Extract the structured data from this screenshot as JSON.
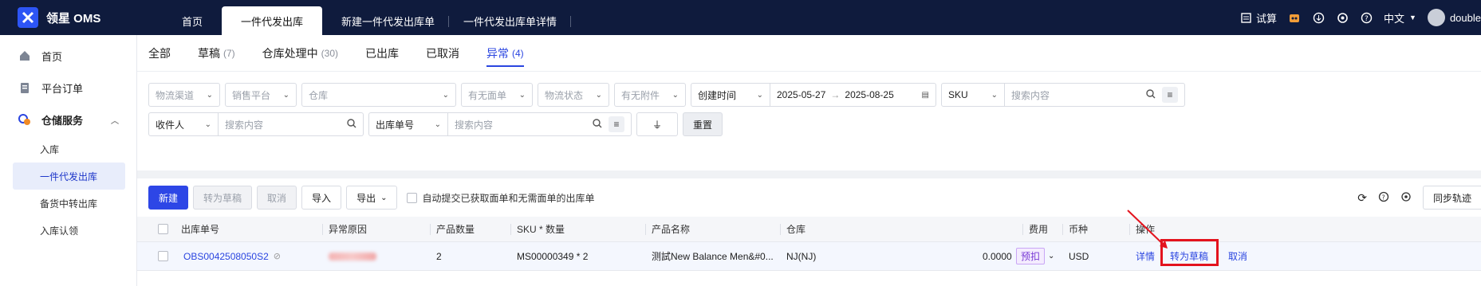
{
  "app": {
    "title": "领星 OMS"
  },
  "topbar": {
    "tabs": [
      {
        "label": "首页"
      },
      {
        "label": "一件代发出库"
      },
      {
        "label": "新建一件代发出库单"
      },
      {
        "label": "一件代发出库单详情"
      }
    ],
    "trial": "试算",
    "language": "中文",
    "user": "double"
  },
  "sidebar": {
    "home": "首页",
    "orders": "平台订单",
    "warehouse": "仓储服务",
    "subitems": [
      "入库",
      "一件代发出库",
      "备货中转出库",
      "入库认领"
    ]
  },
  "status_tabs": [
    {
      "label": "全部",
      "count": ""
    },
    {
      "label": "草稿",
      "count": "(7)"
    },
    {
      "label": "仓库处理中",
      "count": "(30)"
    },
    {
      "label": "已出库",
      "count": ""
    },
    {
      "label": "已取消",
      "count": ""
    },
    {
      "label": "异常",
      "count": "(4)"
    }
  ],
  "filters": {
    "logistics_channel": "物流渠道",
    "sales_platform": "销售平台",
    "warehouse": "仓库",
    "has_waybill": "有无面单",
    "logistics_status": "物流状态",
    "has_attachment": "有无附件",
    "time_type": "创建时间",
    "date_start": "2025-05-27",
    "date_end": "2025-08-25",
    "sku_type": "SKU",
    "search_placeholder": "搜索内容",
    "recipient_type": "收件人",
    "order_type": "出库单号",
    "reset": "重置"
  },
  "toolbar": {
    "new": "新建",
    "to_draft": "转为草稿",
    "cancel": "取消",
    "import": "导入",
    "export": "导出",
    "auto_submit": "自动提交已获取面单和无需面单的出库单",
    "sync_track": "同步轨迹"
  },
  "table": {
    "headers": {
      "order_no": "出库单号",
      "reason": "异常原因",
      "qty": "产品数量",
      "sku_qty": "SKU * 数量",
      "product": "产品名称",
      "warehouse": "仓库",
      "fee": "费用",
      "currency": "币种",
      "ops": "操作"
    },
    "rows": [
      {
        "order_no": "OBS0042508050S2",
        "qty": "2",
        "sku_qty": "MS00000349 * 2",
        "product": "测試New Balance Men&#0...",
        "warehouse": "NJ(NJ)",
        "fee": "0.0000",
        "fee_badge": "预扣",
        "currency": "USD",
        "op_detail": "详情",
        "op_to_draft": "转为草稿",
        "op_cancel": "取消"
      }
    ]
  },
  "colors": {
    "accent": "#2a45e0",
    "topbar": "#0f1b3d",
    "highlight": "#e3131e"
  }
}
